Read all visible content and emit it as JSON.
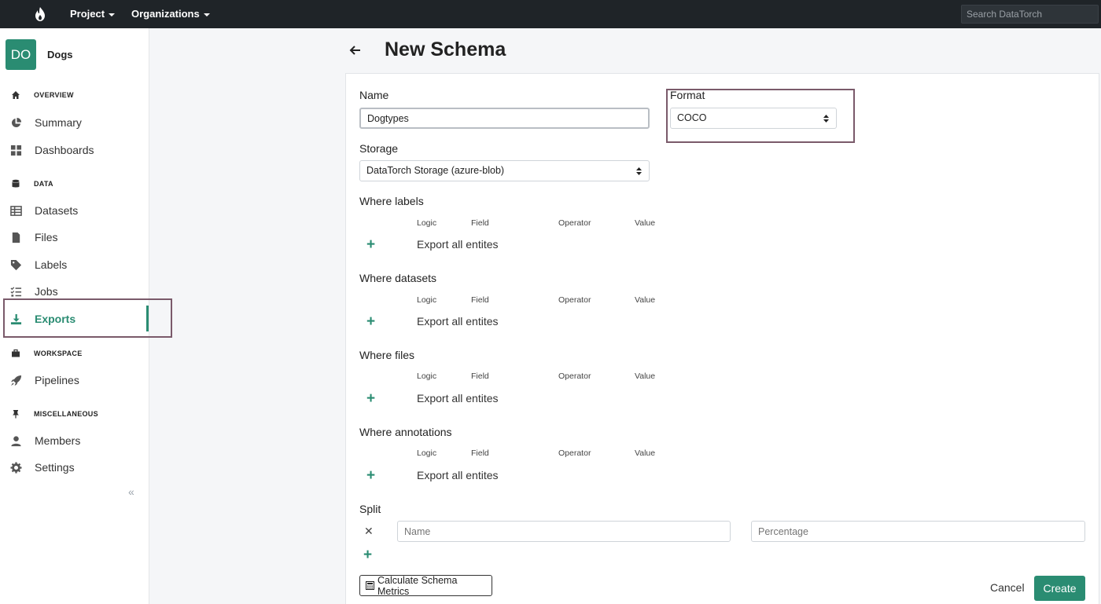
{
  "topbar": {
    "project_label": "Project",
    "organizations_label": "Organizations",
    "search_placeholder": "Search DataTorch"
  },
  "sidebar": {
    "project_initials": "DO",
    "project_name": "Dogs",
    "sections": {
      "overview": "OVERVIEW",
      "data": "DATA",
      "workspace": "WORKSPACE",
      "misc": "MISCELLANEOUS"
    },
    "items": {
      "summary": "Summary",
      "dashboards": "Dashboards",
      "datasets": "Datasets",
      "files": "Files",
      "labels": "Labels",
      "jobs": "Jobs",
      "exports": "Exports",
      "pipelines": "Pipelines",
      "members": "Members",
      "settings": "Settings"
    },
    "active_item": "Exports",
    "collapse_glyph": "«"
  },
  "page": {
    "title": "New Schema"
  },
  "form": {
    "name_label": "Name",
    "name_value": "Dogtypes",
    "format_label": "Format",
    "format_value": "COCO",
    "storage_label": "Storage",
    "storage_value": "DataTorch Storage (azure-blob)",
    "filter_columns": {
      "logic": "Logic",
      "field": "Field",
      "operator": "Operator",
      "value": "Value"
    },
    "export_all_text": "Export all entites",
    "where_labels": "Where labels",
    "where_datasets": "Where datasets",
    "where_files": "Where files",
    "where_annotations": "Where annotations",
    "split_label": "Split",
    "split_name_placeholder": "Name",
    "split_percentage_placeholder": "Percentage",
    "calc_button": "Calculate Schema Metrics",
    "cancel_button": "Cancel",
    "create_button": "Create"
  },
  "colors": {
    "brand": "#2a8c72",
    "topbar": "#1f2428",
    "highlight": "#7a5a6a"
  }
}
